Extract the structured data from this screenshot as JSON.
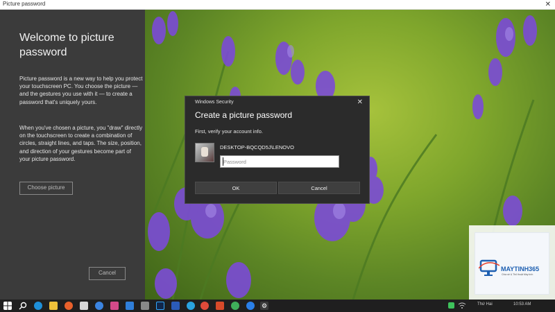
{
  "window": {
    "title": "Picture password",
    "close_glyph": "✕"
  },
  "left": {
    "heading": "Welcome to picture password",
    "paragraph1": "Picture password is a new way to help you protect your touchscreen PC. You choose the picture — and the gestures you use with it — to create a password that's uniquely yours.",
    "paragraph2": "When you've chosen a picture, you \"draw\" directly on the touchscreen to create a combination of circles, straight lines, and taps. The size, position, and direction of your gestures become part of your picture password.",
    "choose_label": "Choose picture",
    "cancel_label": "Cancel"
  },
  "dialog": {
    "caption": "Windows Security",
    "close_glyph": "✕",
    "heading": "Create a picture password",
    "subtext": "First, verify your account info.",
    "account": "DESKTOP-BQCQD5J\\LENOVO",
    "password_placeholder": "Password",
    "ok_label": "OK",
    "cancel_label": "Cancel"
  },
  "watermark": {
    "brand": "MAYTINH365",
    "tagline": "Chia sẻ & Thủ thuật Máy tính"
  },
  "taskbar": {
    "icons": [
      "windows-start-icon",
      "search-icon",
      "edge-icon",
      "file-explorer-icon",
      "firefox-icon",
      "store-icon",
      "photos-icon",
      "app-icon",
      "mail-icon",
      "camera-icon",
      "photoshop-icon",
      "word-icon",
      "telegram-icon",
      "chrome-icon",
      "office-icon",
      "chrome-icon-2",
      "messenger-icon",
      "settings-icon"
    ],
    "tray_date": "Thứ Hai",
    "tray_time": "10:53 AM"
  },
  "colors": {
    "left_pane": "#3b3b3b",
    "dialog": "#2b2b2b",
    "accent_watermark": "#1d5fb1"
  }
}
